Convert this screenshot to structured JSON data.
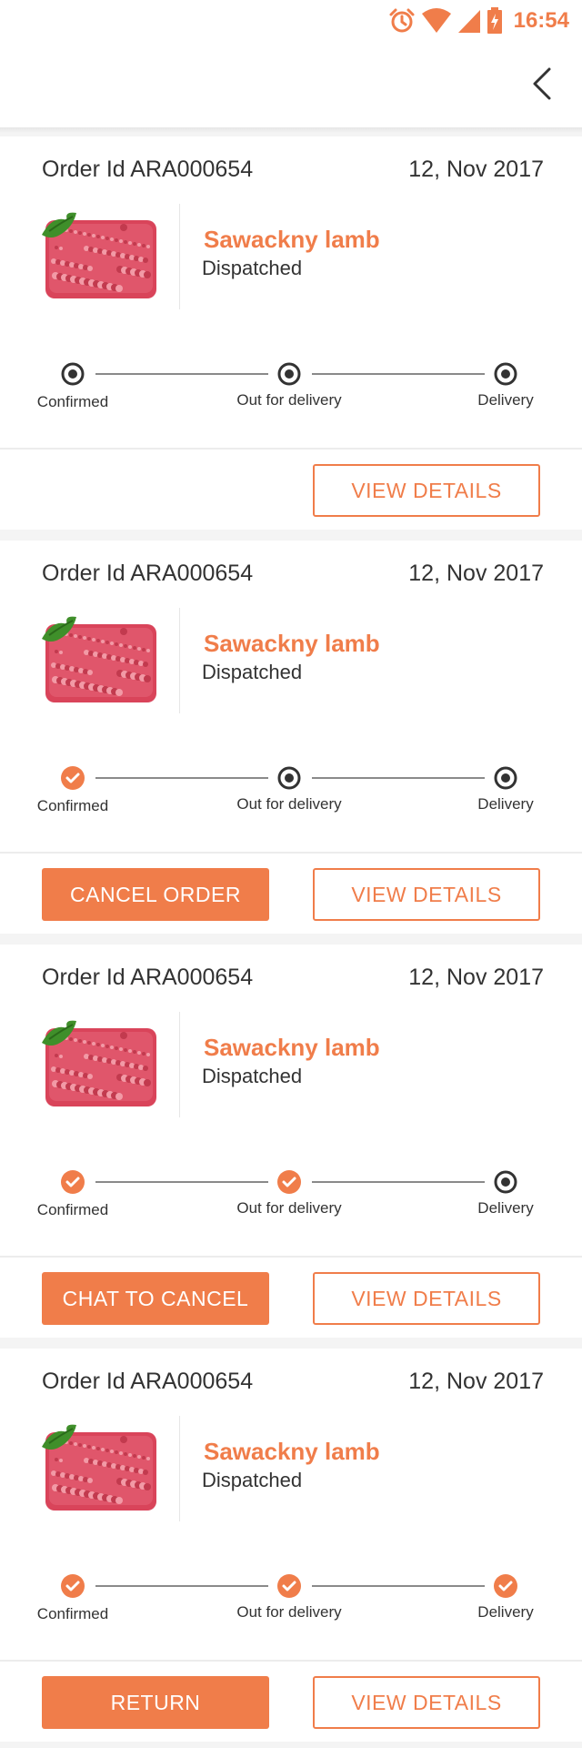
{
  "status_bar": {
    "time": "16:54",
    "icons": [
      "alarm-icon",
      "wifi-icon",
      "signal-icon",
      "battery-charging-icon"
    ]
  },
  "header": {
    "back_icon": "chevron-left-icon"
  },
  "colors": {
    "accent": "#f07d4a",
    "text": "#333333",
    "divider": "#e6e6e6"
  },
  "orders": [
    {
      "order_id": "Order Id ARA000654",
      "date": "12, Nov 2017",
      "product_name": "Sawackny lamb",
      "status": "Dispatched",
      "steps": [
        {
          "label": "Confirmed",
          "done": false
        },
        {
          "label": "Out for delivery",
          "done": false
        },
        {
          "label": "Delivery",
          "done": false
        }
      ],
      "primary_button": "",
      "view_button": "VIEW DETAILS"
    },
    {
      "order_id": "Order Id ARA000654",
      "date": "12, Nov 2017",
      "product_name": "Sawackny lamb",
      "status": "Dispatched",
      "steps": [
        {
          "label": "Confirmed",
          "done": true
        },
        {
          "label": "Out for delivery",
          "done": false
        },
        {
          "label": "Delivery",
          "done": false
        }
      ],
      "primary_button": "CANCEL ORDER",
      "view_button": "VIEW DETAILS"
    },
    {
      "order_id": "Order Id ARA000654",
      "date": "12, Nov 2017",
      "product_name": "Sawackny lamb",
      "status": "Dispatched",
      "steps": [
        {
          "label": "Confirmed",
          "done": true
        },
        {
          "label": "Out for delivery",
          "done": true
        },
        {
          "label": "Delivery",
          "done": false
        }
      ],
      "primary_button": "CHAT TO CANCEL",
      "view_button": "VIEW DETAILS"
    },
    {
      "order_id": "Order Id ARA000654",
      "date": "12, Nov 2017",
      "product_name": "Sawackny lamb",
      "status": "Dispatched",
      "steps": [
        {
          "label": "Confirmed",
          "done": true
        },
        {
          "label": "Out for delivery",
          "done": true
        },
        {
          "label": "Delivery",
          "done": true
        }
      ],
      "primary_button": "RETURN",
      "view_button": "VIEW DETAILS"
    }
  ]
}
